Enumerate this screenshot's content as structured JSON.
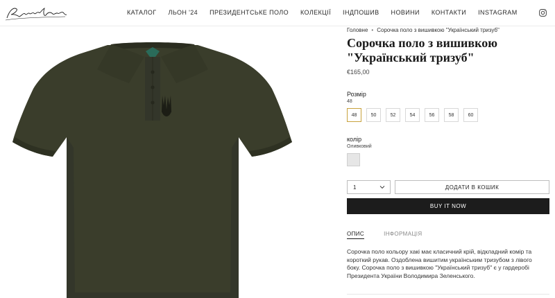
{
  "header": {
    "logo_text": "Edition Prowdy",
    "nav": [
      {
        "label": "КАТАЛОГ"
      },
      {
        "label": "ЛЬОН '24"
      },
      {
        "label": "ПРЕЗИДЕНТСЬКЕ ПОЛО"
      },
      {
        "label": "КОЛЕКЦІЇ"
      },
      {
        "label": "ІНДПОШИВ"
      },
      {
        "label": "НОВИНИ"
      },
      {
        "label": "КОНТАКТИ"
      },
      {
        "label": "INSTAGRAM"
      }
    ]
  },
  "breadcrumb": {
    "home": "Головне",
    "separator": "•",
    "current": "Сорочка поло з вишивкою \"Український тризуб\""
  },
  "product": {
    "title": "Сорочка поло з вишивкою \"Український тризуб\"",
    "price": "€165,00",
    "size_label": "Розмір",
    "size_selected": "48",
    "sizes": [
      "48",
      "50",
      "52",
      "54",
      "56",
      "58",
      "60"
    ],
    "color_label": "колір",
    "color_selected": "Оливковий",
    "shirt_color": "#3a3d2b",
    "quantity": "1",
    "add_to_cart": "ДОДАТИ В КОШИК",
    "buy_now": "BUY IT NOW"
  },
  "tabs": [
    {
      "label": "ОПИС",
      "active": true
    },
    {
      "label": "ІНФОРМАЦІЯ",
      "active": false
    }
  ],
  "description": "Сорочка поло кольору хакі має класичний крій, відкладний комір та короткий рукав. Оздоблена вишитим українським тризубом з лівого боку. Сорочка поло з вишивкою \"Український тризуб\" є у гардеробі Президента України Володимира Зеленського."
}
